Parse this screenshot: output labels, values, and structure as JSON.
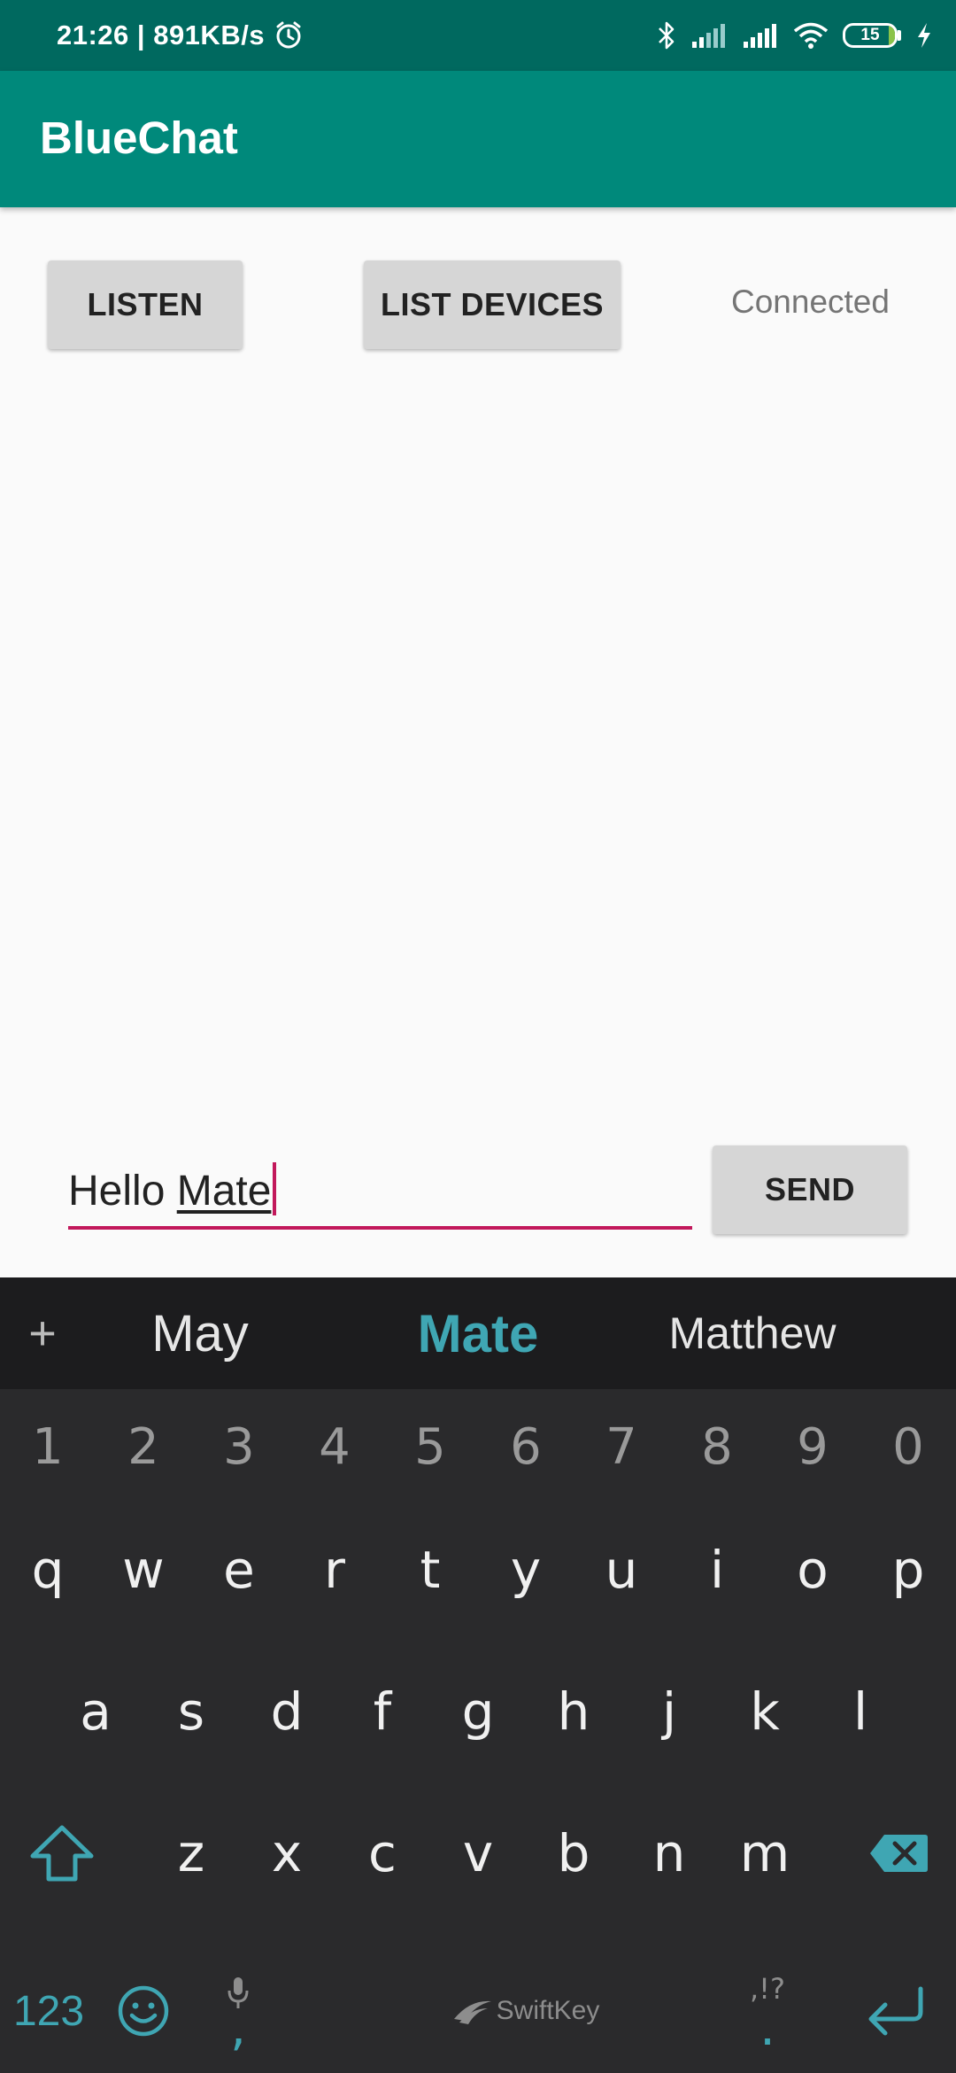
{
  "status_bar": {
    "time": "21:26",
    "speed": "891KB/s",
    "battery": "15",
    "icons": [
      "alarm-icon",
      "bluetooth-icon",
      "signal-icon",
      "signal-icon",
      "wifi-icon",
      "battery-icon",
      "charging-icon"
    ]
  },
  "app": {
    "title": "BlueChat",
    "accent": "#00897b"
  },
  "controls": {
    "listen_label": "LISTEN",
    "list_devices_label": "LIST DEVICES",
    "status": "Connected",
    "send_label": "SEND"
  },
  "message": {
    "plain": "Hello ",
    "composing": "Mate"
  },
  "keyboard": {
    "suggestions": [
      "May",
      "Mate",
      "Matthew"
    ],
    "numbers": [
      "1",
      "2",
      "3",
      "4",
      "5",
      "6",
      "7",
      "8",
      "9",
      "0"
    ],
    "row1": [
      "q",
      "w",
      "e",
      "r",
      "t",
      "y",
      "u",
      "i",
      "o",
      "p"
    ],
    "row2": [
      "a",
      "s",
      "d",
      "f",
      "g",
      "h",
      "j",
      "k",
      "l"
    ],
    "row3": [
      "z",
      "x",
      "c",
      "v",
      "b",
      "n",
      "m"
    ],
    "mode_label": "123",
    "comma": ",",
    "period": ".",
    "punct_hint": ",!?",
    "brand": "SwiftKey"
  }
}
